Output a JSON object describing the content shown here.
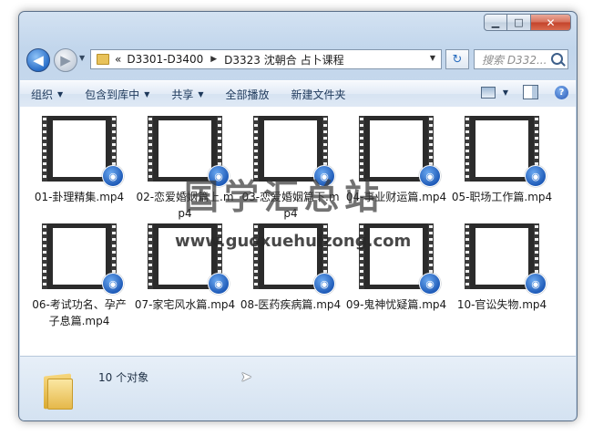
{
  "window": {
    "caption": {
      "minimize": "▁",
      "maximize": "□",
      "close": "✕"
    }
  },
  "nav": {
    "back_glyph": "◀",
    "forward_glyph": "▶",
    "breadcrumb_prefix": "«",
    "breadcrumbs": [
      "D3301-D3400",
      "D3323 沈朝合 占卜课程"
    ],
    "refresh_glyph": "↻",
    "search_placeholder": "搜索 D332..."
  },
  "toolbar": {
    "organize": "组织",
    "include_in_library": "包含到库中",
    "share": "共享",
    "play_all": "全部播放",
    "new_folder": "新建文件夹"
  },
  "files": [
    {
      "name": "01-卦理精集.mp4"
    },
    {
      "name": "02-恋爱婚姻篇上.mp4"
    },
    {
      "name": "03-恋爱婚姻篇下.mp4"
    },
    {
      "name": "04-事业财运篇.mp4"
    },
    {
      "name": "05-职场工作篇.mp4"
    },
    {
      "name": "06-考试功名、孕产子息篇.mp4"
    },
    {
      "name": "07-家宅风水篇.mp4"
    },
    {
      "name": "08-医药疾病篇.mp4"
    },
    {
      "name": "09-鬼神忧疑篇.mp4"
    },
    {
      "name": "10-官讼失物.mp4"
    }
  ],
  "status": {
    "count_text": "10 个对象"
  },
  "watermark": {
    "title": "国学汇总站",
    "url": "www.guoxuehuizong.com"
  },
  "icons": {
    "media_badge": "wmp-badge-icon",
    "status_folder": "folder-icon"
  }
}
